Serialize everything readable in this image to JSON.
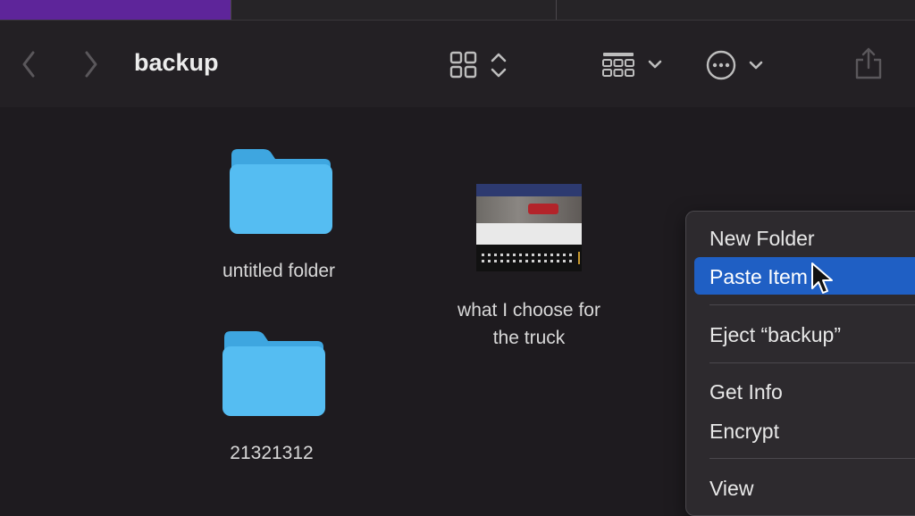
{
  "window": {
    "title": "backup"
  },
  "toolbar": {
    "back_icon": "chevron-left-icon",
    "forward_icon": "chevron-right-icon",
    "view_icon": "grid-view-icon",
    "group_icon": "group-icon",
    "action_icon": "ellipsis-circle-icon",
    "share_icon": "share-icon"
  },
  "items": [
    {
      "name": "untitled folder",
      "kind": "folder"
    },
    {
      "name": "21321312",
      "kind": "folder"
    },
    {
      "name_line1": "what I choose for",
      "name_line2": "the truck",
      "kind": "image"
    }
  ],
  "context_menu": {
    "items": [
      {
        "label": "New Folder"
      },
      {
        "label": "Paste Item",
        "highlighted": true
      },
      {
        "label": "Eject “backup”"
      },
      {
        "label": "Get Info"
      },
      {
        "label": "Encrypt"
      },
      {
        "label": "View"
      }
    ]
  },
  "colors": {
    "folder": "#55bdf2",
    "folder_tab": "#3ea6e0",
    "highlight": "#1f5fc4",
    "background": "#1e1b1f"
  }
}
